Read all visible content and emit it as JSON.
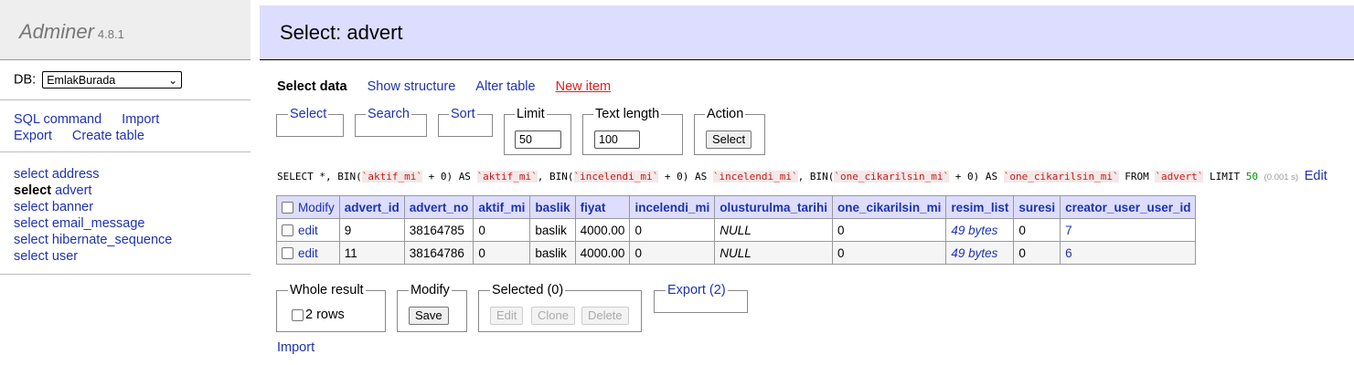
{
  "app": {
    "name": "Adminer",
    "version": "4.8.1"
  },
  "db": {
    "label": "DB:",
    "selected": "EmlakBurada"
  },
  "sidebar": {
    "links": [
      "SQL command",
      "Import",
      "Export",
      "Create table"
    ],
    "tables": [
      {
        "prefix": "select",
        "name": "address"
      },
      {
        "prefix": "select",
        "name": "advert",
        "active": true
      },
      {
        "prefix": "select",
        "name": "banner"
      },
      {
        "prefix": "select",
        "name": "email_message"
      },
      {
        "prefix": "select",
        "name": "hibernate_sequence"
      },
      {
        "prefix": "select",
        "name": "user"
      }
    ]
  },
  "page": {
    "title": "Select: advert"
  },
  "tabs": {
    "select_data": "Select data",
    "show_structure": "Show structure",
    "alter_table": "Alter table",
    "new_item": "New item"
  },
  "filters": {
    "select": "Select",
    "search": "Search",
    "sort": "Sort",
    "limit_label": "Limit",
    "limit_value": "50",
    "text_length_label": "Text length",
    "text_length_value": "100",
    "action_label": "Action",
    "action_button": "Select"
  },
  "sql": {
    "parts": [
      "SELECT *, BIN(",
      "`aktif_mi`",
      " + 0) AS ",
      "`aktif_mi`",
      ", BIN(",
      "`incelendi_mi`",
      " + 0) AS ",
      "`incelendi_mi`",
      ", BIN(",
      "`one_cikarilsin_mi`",
      " + 0) AS ",
      "`one_cikarilsin_mi`",
      " FROM ",
      "`advert`",
      " LIMIT "
    ],
    "limit": "50",
    "time": "(0.001 s)",
    "edit": "Edit"
  },
  "table": {
    "modify_header": "Modify",
    "columns": [
      "advert_id",
      "advert_no",
      "aktif_mi",
      "baslik",
      "fiyat",
      "incelendi_mi",
      "olusturulma_tarihi",
      "one_cikarilsin_mi",
      "resim_list",
      "suresi",
      "creator_user_user_id"
    ],
    "rows": [
      {
        "edit": "edit",
        "cells": [
          "9",
          "38164785",
          "0",
          "baslik",
          "4000.00",
          "0",
          "NULL",
          "0",
          "49 bytes",
          "0",
          "7"
        ]
      },
      {
        "edit": "edit",
        "cells": [
          "11",
          "38164786",
          "0",
          "baslik",
          "4000.00",
          "0",
          "NULL",
          "0",
          "49 bytes",
          "0",
          "6"
        ]
      }
    ]
  },
  "bottom": {
    "whole_result": "Whole result",
    "rows_label": "2 rows",
    "modify": "Modify",
    "save": "Save",
    "selected": "Selected (0)",
    "edit": "Edit",
    "clone": "Clone",
    "delete": "Delete",
    "export": "Export (2)",
    "import": "Import"
  }
}
